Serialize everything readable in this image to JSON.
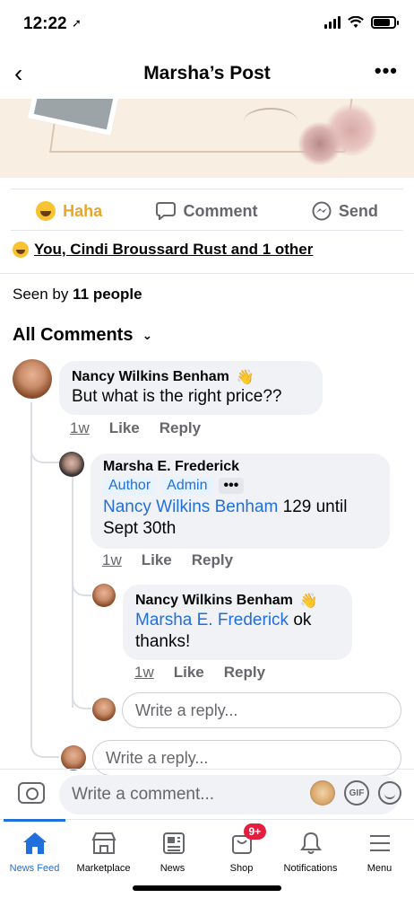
{
  "status_bar": {
    "time": "12:22",
    "location_glyph": "➚"
  },
  "header": {
    "back_glyph": "‹",
    "title": "Marsha’s Post",
    "more_glyph": "•••"
  },
  "actions": {
    "haha": "Haha",
    "comment": "Comment",
    "send": "Send"
  },
  "reactions": {
    "summary": "You, Cindi Broussard Rust and 1 other"
  },
  "seen": {
    "prefix": "Seen by",
    "count": "11 people"
  },
  "comments_header": {
    "label": "All Comments"
  },
  "comments": [
    {
      "author": "Nancy Wilkins Benham",
      "text": "But what is the right price??",
      "time": "1w",
      "like": "Like",
      "reply": "Reply",
      "replies": [
        {
          "author": "Marsha E. Frederick",
          "tags": [
            "Author",
            "Admin"
          ],
          "tag_more": "•••",
          "mention": "Nancy Wilkins Benham",
          "text": " 129 until Sept 30th",
          "time": "1w",
          "like": "Like",
          "reply": "Reply"
        },
        {
          "author": "Nancy Wilkins Benham",
          "mention": "Marsha E. Frederick",
          "text": " ok thanks!",
          "time": "1w",
          "like": "Like",
          "reply": "Reply"
        }
      ],
      "reply_placeholder": "Write a reply..."
    }
  ],
  "outer_reply_placeholder": "Write a reply...",
  "compose": {
    "placeholder": "Write a comment...",
    "gif_label": "GIF"
  },
  "tabs": [
    {
      "label": "News Feed",
      "icon": "home-icon",
      "active": true
    },
    {
      "label": "Marketplace",
      "icon": "marketplace-icon"
    },
    {
      "label": "News",
      "icon": "news-icon"
    },
    {
      "label": "Shop",
      "icon": "shop-icon",
      "badge": "9+"
    },
    {
      "label": "Notifications",
      "icon": "bell-icon"
    },
    {
      "label": "Menu",
      "icon": "menu-icon"
    }
  ],
  "colors": {
    "accent": "#216fdb",
    "haha": "#e9a62b",
    "badge": "#e41e3f",
    "bubble": "#f0f2f5"
  }
}
